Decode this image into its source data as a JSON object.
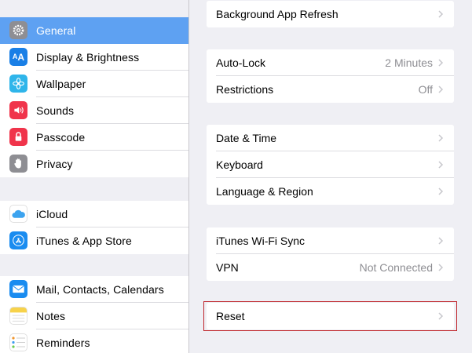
{
  "sidebar": {
    "items": [
      {
        "label": "General",
        "icon": "gear-icon",
        "color": "#8e8e93",
        "selected": true
      },
      {
        "label": "Display & Brightness",
        "icon": "text-size-icon",
        "color": "#1a7fe6"
      },
      {
        "label": "Wallpaper",
        "icon": "flower-icon",
        "color": "#2fb5ea"
      },
      {
        "label": "Sounds",
        "icon": "speaker-icon",
        "color": "#f0344b"
      },
      {
        "label": "Passcode",
        "icon": "lock-icon",
        "color": "#f0344b"
      },
      {
        "label": "Privacy",
        "icon": "hand-icon",
        "color": "#8e8e93"
      },
      {
        "label": "iCloud",
        "icon": "cloud-icon",
        "color": "#ffffff"
      },
      {
        "label": "iTunes & App Store",
        "icon": "app-store-icon",
        "color": "#1a8cf0"
      },
      {
        "label": "Mail, Contacts, Calendars",
        "icon": "mail-icon",
        "color": "#1a8cf0"
      },
      {
        "label": "Notes",
        "icon": "notes-icon",
        "color": "#ffffff"
      },
      {
        "label": "Reminders",
        "icon": "reminders-icon",
        "color": "#ffffff"
      }
    ]
  },
  "main": {
    "background_refresh": {
      "label": "Background App Refresh"
    },
    "auto_lock": {
      "label": "Auto-Lock",
      "value": "2 Minutes"
    },
    "restrictions": {
      "label": "Restrictions",
      "value": "Off"
    },
    "date_time": {
      "label": "Date & Time"
    },
    "keyboard": {
      "label": "Keyboard"
    },
    "language_region": {
      "label": "Language & Region"
    },
    "itunes_sync": {
      "label": "iTunes Wi-Fi Sync"
    },
    "vpn": {
      "label": "VPN",
      "value": "Not Connected"
    },
    "reset": {
      "label": "Reset"
    }
  },
  "colors": {
    "selection": "#5ea1f2",
    "highlight_border": "#c0272d",
    "secondary_text": "#8e8e93",
    "background": "#efeff4"
  }
}
